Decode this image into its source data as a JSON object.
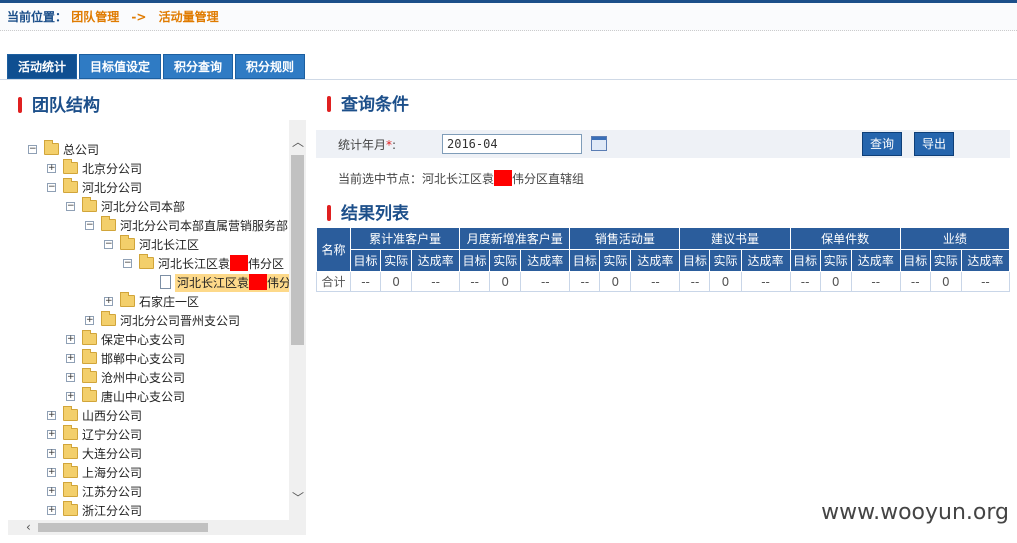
{
  "breadcrumb": {
    "label": "当前位置：",
    "level1": "团队管理",
    "arrow": "->",
    "level2": "活动量管理"
  },
  "tabs": [
    {
      "label": "活动统计",
      "active": true
    },
    {
      "label": "目标值设定",
      "active": false
    },
    {
      "label": "积分查询",
      "active": false
    },
    {
      "label": "积分规则",
      "active": false
    }
  ],
  "left_panel": {
    "title": "团队结构"
  },
  "tree": {
    "root": "总公司",
    "beijing": "北京分公司",
    "hebei": "河北分公司",
    "hebei_hq": "河北分公司本部",
    "hebei_direct": "河北分公司本部直属营销服务部",
    "changjiang": "河北长江区",
    "yuan_pre": "河北长江区袁",
    "yuan_post": "伟分区",
    "selected_pre": "河北长江区袁",
    "selected_post": "伟分",
    "shijiazhuang": "石家庄一区",
    "jinzhou": "河北分公司晋州支公司",
    "baoding": "保定中心支公司",
    "handan": "邯郸中心支公司",
    "cangzhou": "沧州中心支公司",
    "tangshan": "唐山中心支公司",
    "shanxi": "山西分公司",
    "liaoning": "辽宁分公司",
    "dalian": "大连分公司",
    "shanghai": "上海分公司",
    "jiangsu": "江苏分公司",
    "zhejiang": "浙江分公司"
  },
  "query": {
    "title": "查询条件",
    "month_label": "统计年月",
    "required_mark": "*",
    "colon": ":",
    "month_value": "2016-04",
    "search_button": "查询",
    "export_button": "导出",
    "current_node_label": "当前选中节点：",
    "current_node_pre": "河北长江区袁",
    "current_node_post": "伟分区直辖组"
  },
  "results": {
    "title": "结果列表",
    "name_header": "名称",
    "groups": [
      "累计准客户量",
      "月度新增准客户量",
      "销售活动量",
      "建议书量",
      "保单件数",
      "业绩"
    ],
    "sub_headers": [
      "目标",
      "实际",
      "达成率"
    ],
    "total_row": {
      "name": "合计",
      "cells": [
        "--",
        "0",
        "--",
        "--",
        "0",
        "--",
        "--",
        "0",
        "--",
        "--",
        "0",
        "--",
        "--",
        "0",
        "--",
        "--",
        "0",
        "--"
      ]
    }
  },
  "watermark": "www.wooyun.org",
  "colors": {
    "header_blue": "#2b5d9c",
    "accent_red": "#e02020",
    "crumb_orange": "#e07b00"
  }
}
